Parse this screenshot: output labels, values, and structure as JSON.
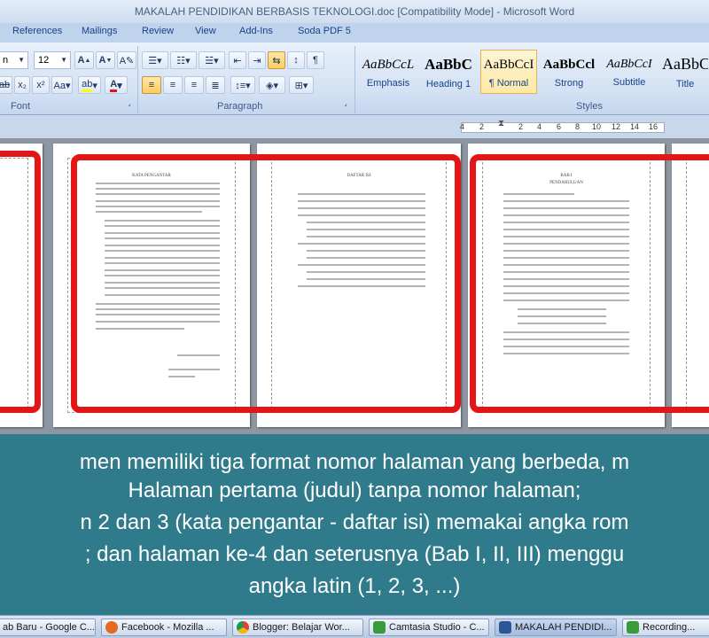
{
  "window": {
    "title": "MAKALAH PENDIDIKAN BERBASIS TEKNOLOGI.doc [Compatibility Mode] - Microsoft Word"
  },
  "tabs": [
    "References",
    "Mailings",
    "Review",
    "View",
    "Add-Ins",
    "Soda PDF 5"
  ],
  "font": {
    "name_partial": "n",
    "size": "12",
    "group_label": "Font"
  },
  "paragraph": {
    "group_label": "Paragraph"
  },
  "styles": {
    "group_label": "Styles",
    "items": [
      {
        "sample": "AaBbCcL",
        "name": "Emphasis"
      },
      {
        "sample": "AaBbC",
        "name": "Heading 1"
      },
      {
        "sample": "AaBbCcI",
        "name": "¶ Normal"
      },
      {
        "sample": "AaBbCcl",
        "name": "Strong"
      },
      {
        "sample": "AaBbCcI",
        "name": "Subtitle"
      },
      {
        "sample": "AaBbC",
        "name": "Title"
      }
    ]
  },
  "ruler": {
    "marks": [
      "4",
      "2",
      "2",
      "4",
      "6",
      "8",
      "10",
      "12",
      "14",
      "16"
    ]
  },
  "pages": {
    "p2_title": "KATA PENGANTAR",
    "p3_title": "DAFTAR ISI",
    "p4_title": "BAB I",
    "p4_subtitle": "PENDAHULUAN"
  },
  "caption": {
    "lines": [
      "men memiliki tiga format nomor halaman yang berbeda, m",
      "Halaman pertama (judul) tanpa nomor halaman;",
      "n 2 dan 3 (kata pengantar - daftar isi) memakai angka rom",
      "; dan halaman ke-4 dan seterusnya (Bab I, II, III) menggu",
      "angka latin (1, 2, 3, ...)"
    ]
  },
  "taskbar": {
    "items": [
      "ab Baru - Google C...",
      "Facebook - Mozilla ...",
      "Blogger: Belajar Wor...",
      "Camtasia Studio - C...",
      "MAKALAH PENDIDI...",
      "Recording..."
    ]
  }
}
